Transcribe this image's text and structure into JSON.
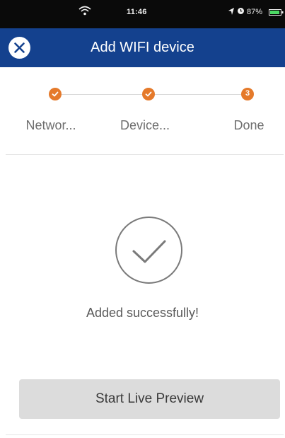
{
  "status_bar": {
    "time": "11:46",
    "battery_percent": "87%",
    "icons": [
      "wifi-icon",
      "location-arrow-icon",
      "alarm-icon",
      "battery-icon"
    ]
  },
  "header": {
    "title": "Add WIFI device",
    "close_icon": "close-icon"
  },
  "steps": [
    {
      "label": "Networ...",
      "state": "completed",
      "icon": "check-icon"
    },
    {
      "label": "Device...",
      "state": "completed",
      "icon": "check-icon"
    },
    {
      "label": "Done",
      "state": "current",
      "number": "3"
    }
  ],
  "success": {
    "icon": "checkmark-circle-icon",
    "message": "Added successfully!"
  },
  "actions": {
    "start_live_preview_label": "Start Live Preview"
  },
  "colors": {
    "header_background": "#14418e",
    "step_accent": "#e57a2b",
    "button_background": "#dcdcdc"
  }
}
